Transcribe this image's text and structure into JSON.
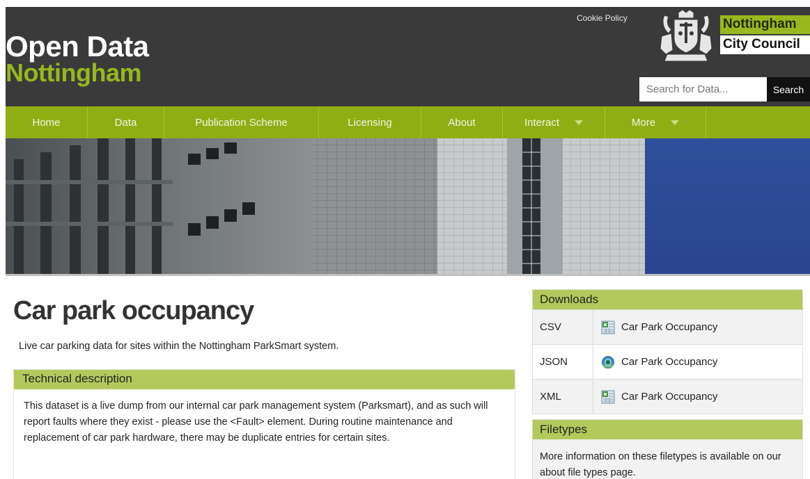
{
  "header": {
    "logo_line1": "Open Data",
    "logo_line2": "Nottingham",
    "cookie_link": "Cookie Policy",
    "council_line1": "Nottingham",
    "council_line2": "City Council",
    "search_placeholder": "Search for Data...",
    "search_button": "Search"
  },
  "nav": {
    "items": [
      {
        "label": "Home"
      },
      {
        "label": "Data"
      },
      {
        "label": "Publication Scheme"
      },
      {
        "label": "Licensing"
      },
      {
        "label": "About"
      },
      {
        "label": "Interact",
        "dropdown": true
      },
      {
        "label": "More",
        "dropdown": true
      }
    ]
  },
  "main": {
    "title": "Car park occupancy",
    "lead": "Live car parking data for sites within the Nottingham ParkSmart system.",
    "tech_header": "Technical description",
    "tech_body": "This dataset is a live dump from our internal car park management system (Parksmart), and as such will report faults where they exist - please use the <Fault> element. During routine maintenance and replacement of car park hardware, there may be duplicate entries for certain sites."
  },
  "sidebar": {
    "downloads_header": "Downloads",
    "downloads": [
      {
        "type": "CSV",
        "label": "Car Park Occupancy",
        "icon": "spreadsheet-icon"
      },
      {
        "type": "JSON",
        "label": "Car Park Occupancy",
        "icon": "globe-icon"
      },
      {
        "type": "XML",
        "label": "Car Park Occupancy",
        "icon": "spreadsheet-icon"
      }
    ],
    "filetypes_header": "Filetypes",
    "filetypes_body": "More information on these filetypes is available on our about file types page."
  },
  "colors": {
    "brand_green": "#8fae14",
    "panel_header": "#b3c95c",
    "header_bg": "#3a3a3a"
  }
}
